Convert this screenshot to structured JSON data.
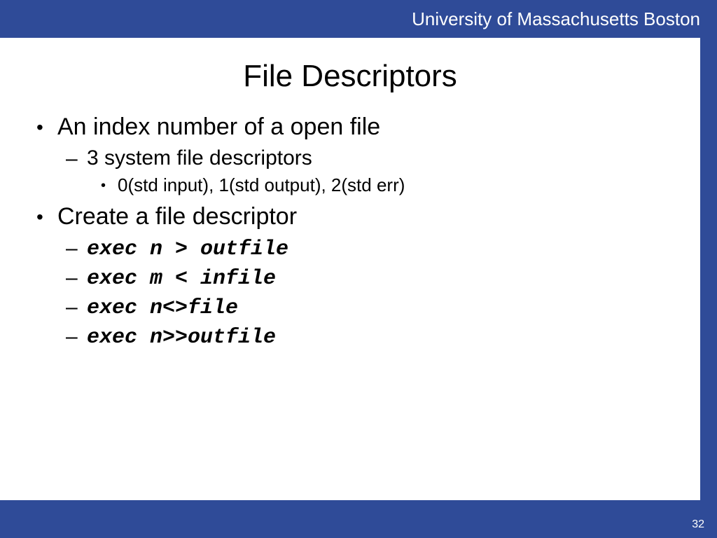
{
  "header": {
    "org": "University of Massachusetts Boston"
  },
  "slide": {
    "title": "File Descriptors",
    "bullets": [
      {
        "text": "An index number of a open file",
        "sub": [
          {
            "text": "3 system file descriptors",
            "sub": [
              {
                "text": "0(std input), 1(std output), 2(std err)"
              }
            ]
          }
        ]
      },
      {
        "text": "Create a file descriptor",
        "sub": [
          {
            "code": "exec n > outfile"
          },
          {
            "code": "exec m < infile"
          },
          {
            "code": "exec n<>file"
          },
          {
            "code": "exec n>>outfile"
          }
        ]
      }
    ],
    "page_number": "32"
  }
}
